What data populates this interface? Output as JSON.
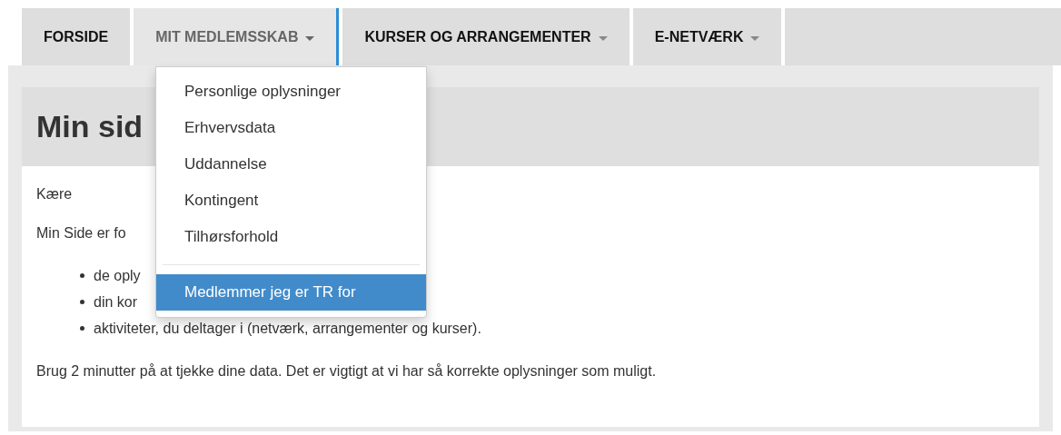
{
  "nav": [
    {
      "label": "FORSIDE",
      "dropdown": false,
      "open": false
    },
    {
      "label": "MIT MEDLEMSSKAB",
      "dropdown": true,
      "open": true
    },
    {
      "label": "KURSER OG ARRANGEMENTER",
      "dropdown": true,
      "open": false
    },
    {
      "label": "E-NETVÆRK",
      "dropdown": true,
      "open": false
    }
  ],
  "menu": {
    "items": [
      {
        "label": "Personlige oplysninger",
        "selected": false
      },
      {
        "label": "Erhvervsdata",
        "selected": false
      },
      {
        "label": "Uddannelse",
        "selected": false
      },
      {
        "label": "Kontingent",
        "selected": false
      },
      {
        "label": "Tilhørsforhold",
        "selected": false,
        "divider_after": true
      },
      {
        "label": "Medlemmer jeg er TR for",
        "selected": true
      }
    ]
  },
  "page": {
    "title": "Min sid",
    "greeting": "Kære",
    "intro": "Min Side er fo",
    "bullets": [
      "de oply",
      "din kor",
      "aktiviteter, du deltager i (netværk, arrangementer og kurser)."
    ],
    "note": "Brug 2 minutter på at tjekke dine data. Det er vigtigt at vi har så korrekte oplysninger som muligt."
  }
}
